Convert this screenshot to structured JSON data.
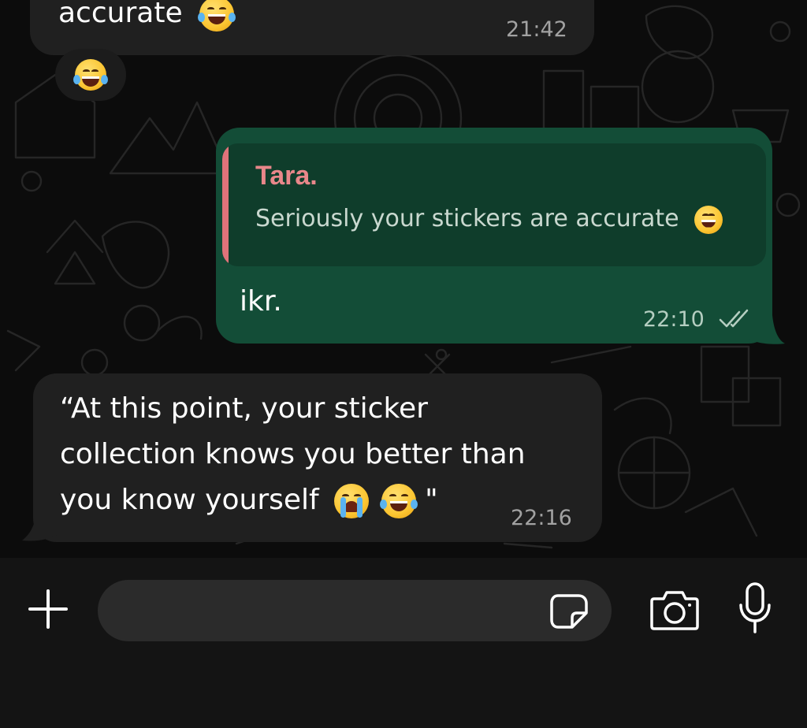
{
  "messages": {
    "first": {
      "text": "accurate",
      "time": "21:42",
      "reaction": "😂"
    },
    "reply": {
      "quote_author": "Tara.",
      "quote_text": "Seriously your stickers are accurate",
      "text": "ikr.",
      "time": "22:10",
      "status": "read"
    },
    "last": {
      "line1": "“At this point, your sticker",
      "line2": "collection knows you better than",
      "line3_prefix": "you know yourself",
      "line3_suffix": "\"",
      "time": "22:16"
    }
  },
  "composer": {
    "placeholder": "",
    "value": ""
  },
  "icons": {
    "attach": "plus-icon",
    "sticker": "sticker-icon",
    "camera": "camera-icon",
    "mic": "microphone-icon"
  },
  "colors": {
    "outgoing_bubble": "#134d37",
    "incoming_bubble": "#202020",
    "quote_accent": "#e0737a",
    "background": "#0c0c0c"
  }
}
